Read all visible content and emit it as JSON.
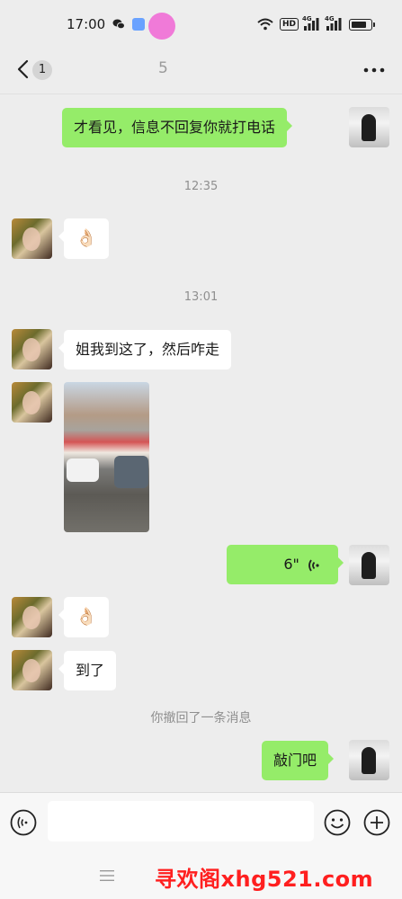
{
  "status_bar": {
    "time": "17:00",
    "hd_label": "HD",
    "signal1_label": "4G",
    "signal2_label": "4G"
  },
  "nav": {
    "unread_count": "1",
    "title": "5"
  },
  "messages": [
    {
      "from": "me",
      "text": "才看见，信息不回复你就打电话"
    },
    {
      "timestamp": "12:35"
    },
    {
      "from": "them",
      "icon": "ok-hand-emoji",
      "text": "👌🏻"
    },
    {
      "timestamp": "13:01"
    },
    {
      "from": "them",
      "text": "姐我到这了，然后咋走"
    },
    {
      "from": "them",
      "image": "street-photo"
    },
    {
      "from": "me",
      "voice_duration": "6\""
    },
    {
      "from": "them",
      "icon": "ok-hand-emoji",
      "text": "👌🏻"
    },
    {
      "from": "them",
      "text": "到了"
    },
    {
      "system": "你撤回了一条消息"
    },
    {
      "from": "me",
      "text": "敲门吧"
    }
  ],
  "input": {
    "value": "",
    "placeholder": ""
  },
  "watermark": "寻欢阁xhg521.com",
  "colors": {
    "background": "#ededed",
    "my_bubble": "#95ec69",
    "their_bubble": "#ffffff",
    "watermark": "#ff1f1f"
  }
}
